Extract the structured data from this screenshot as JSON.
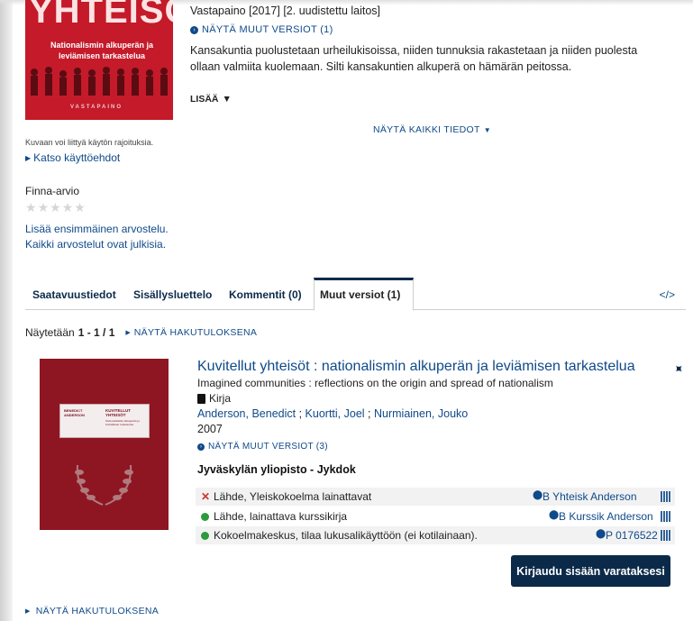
{
  "record": {
    "cover": {
      "title_text": "YHTEISÖT",
      "subtitle": "Nationalismin alkuperän ja leviämisen tarkastelua",
      "publisher_mark": "VASTAPAINO"
    },
    "publisher": "Vastapaino [2017] [2. uudistettu laitos]",
    "other_versions_link": "NÄYTÄ MUUT VERSIOT (1)",
    "description": "Kansakuntia puolustetaan urheilukisoissa, niiden tunnuksia rakastetaan ja niiden puolesta ollaan valmiita kuolemaan. Silti kansakuntien alkuperä on hämärän peitossa.",
    "more": "LISÄÄ",
    "show_all": "NÄYTÄ KAIKKI TIEDOT",
    "image_notice": "Kuvaan voi liittyä käytön rajoituksia.",
    "terms_link": "Katso käyttöehdot",
    "rating_label": "Finna-arvio",
    "add_review": "Lisää ensimmäinen arvostelu.",
    "reviews_public": "Kaikki arvostelut ovat julkisia."
  },
  "tabs": [
    {
      "label": "Saatavuustiedot"
    },
    {
      "label": "Sisällysluettelo"
    },
    {
      "label": "Kommentit (0)"
    },
    {
      "label": "Muut versiot (1)"
    }
  ],
  "embed_icon": "</>",
  "results": {
    "showing_prefix": "Näytetään",
    "showing_range": "1 - 1 / 1",
    "show_as_results": "NÄYTÄ HAKUTULOKSENA"
  },
  "version": {
    "cover": {
      "author_line": "BENEDICT ANDERSON",
      "title_line": "KUVITELLUT YHTEISÖT",
      "subtitle_line": "Nationalismin alkuperän ja leviämisen tarkastelua"
    },
    "title": "Kuvitellut yhteisöt : nationalismin alkuperän ja leviämisen tarkastelua",
    "original_title": "Imagined communities : reflections on the origin and spread of nationalism",
    "format": "Kirja",
    "authors": [
      "Anderson, Benedict",
      "Kuortti, Joel",
      "Nurmiainen, Jouko"
    ],
    "year": "2007",
    "other_versions": "NÄYTÄ MUUT VERSIOT (3)",
    "library": "Jyväskylän yliopisto - Jykdok",
    "holdings": [
      {
        "status": "unavailable",
        "location": "Lähde, Yleiskokoelma lainattavat",
        "callnumber": "B Yhteisk Anderson"
      },
      {
        "status": "available",
        "location": "Lähde, lainattava kurssikirja",
        "callnumber": "B Kurssik Anderson"
      },
      {
        "status": "available",
        "location": "Kokoelmakeskus, tilaa lukusalikäyttöön (ei kotilainaan).",
        "callnumber": "P 0176522"
      }
    ],
    "login_button": "Kirjaudu sisään varataksesi"
  },
  "footer_link": "NÄYTÄ HAKUTULOKSENA",
  "colors": {
    "link": "#0f4a8a",
    "accent": "#0b2a4a",
    "unavailable": "#d0342c",
    "available": "#2e9a3e",
    "cover_red": "#c41a2a"
  }
}
